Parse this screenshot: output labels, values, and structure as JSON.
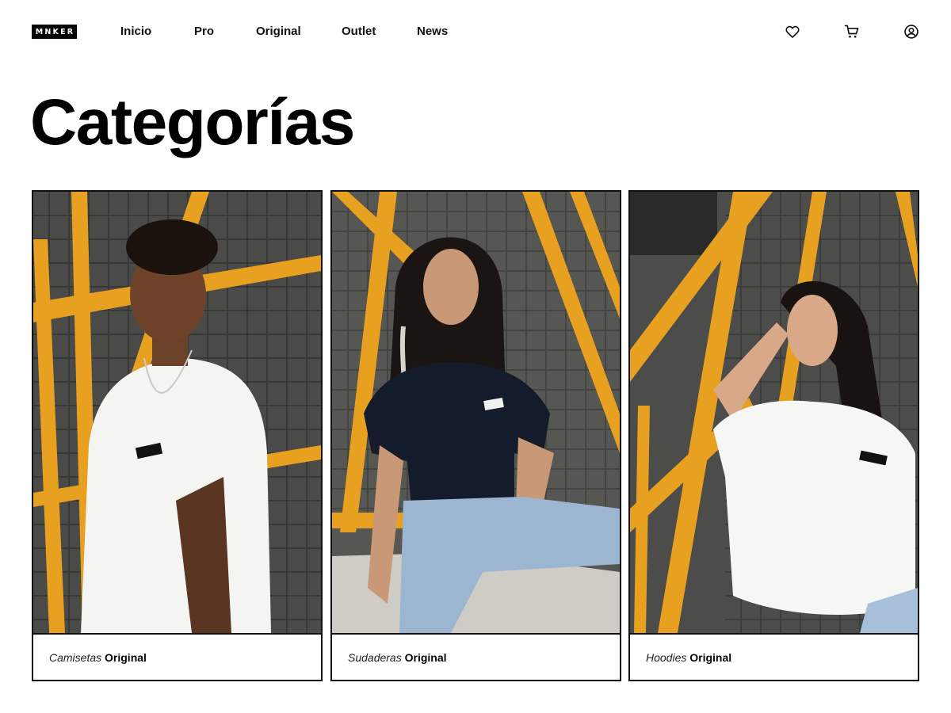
{
  "brand": {
    "logo_text": "MNKER"
  },
  "nav": {
    "items": [
      "Inicio",
      "Pro",
      "Original",
      "Outlet",
      "News"
    ]
  },
  "header_icons": [
    "heart-icon",
    "cart-icon",
    "user-icon"
  ],
  "page": {
    "title": "Categorías"
  },
  "categories": [
    {
      "category": "Camisetas",
      "line": "Original",
      "photo": "man-white-tshirt-photo"
    },
    {
      "category": "Sudaderas",
      "line": "Original",
      "photo": "woman-navy-tshirt-photo"
    },
    {
      "category": "Hoodies",
      "line": "Original",
      "photo": "woman-white-tshirt-photo"
    }
  ],
  "colors": {
    "text": "#111111",
    "background": "#ffffff",
    "accent_orange": "#e8a020",
    "border": "#111111"
  }
}
